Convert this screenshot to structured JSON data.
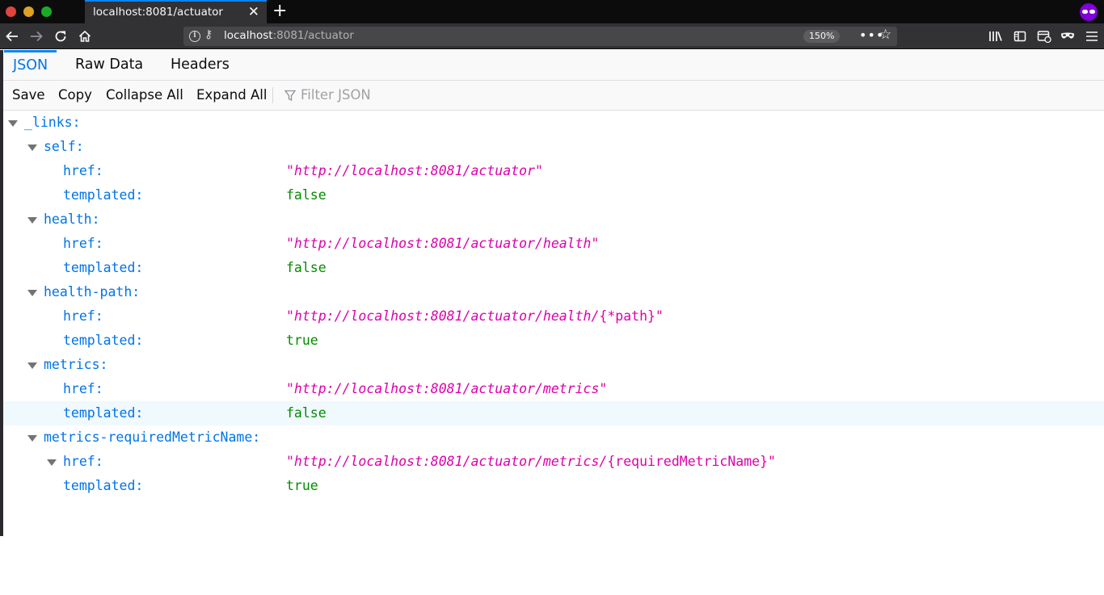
{
  "window": {
    "tab_title": "localhost:8081/actuator",
    "tab_close_glyph": "✕",
    "new_tab_glyph": "+"
  },
  "navbar": {
    "url_host": "localhost",
    "url_rest": ":8081/actuator",
    "zoom": "150%",
    "url_more_glyph": "•••",
    "bookmark_glyph": "☆"
  },
  "json_viewer": {
    "tabs": [
      {
        "label": "JSON",
        "active": true
      },
      {
        "label": "Raw Data",
        "active": false
      },
      {
        "label": "Headers",
        "active": false
      }
    ],
    "toolbar": {
      "save": "Save",
      "copy": "Copy",
      "collapse_all": "Collapse All",
      "expand_all": "Expand All",
      "filter_placeholder": "Filter JSON"
    },
    "tree": {
      "root_key": "_links:",
      "self": {
        "key": "self:",
        "href_key": "href:",
        "href_value": "\"http://localhost:8081/actuator\"",
        "templated_key": "templated:",
        "templated_value": "false"
      },
      "health": {
        "key": "health:",
        "href_key": "href:",
        "href_value": "\"http://localhost:8081/actuator/health\"",
        "templated_key": "templated:",
        "templated_value": "false"
      },
      "health_path": {
        "key": "health-path:",
        "href_key": "href:",
        "href_value_url": "\"http://localhost:8081/actuator/health/",
        "href_value_tail": "{*path}\"",
        "templated_key": "templated:",
        "templated_value": "true"
      },
      "metrics": {
        "key": "metrics:",
        "href_key": "href:",
        "href_value": "\"http://localhost:8081/actuator/metrics\"",
        "templated_key": "templated:",
        "templated_value": "false"
      },
      "metrics_required": {
        "key": "metrics-requiredMetricName:",
        "href_key": "href:",
        "href_value_url": "\"http://localhost:8081/actuator/metrics/",
        "href_value_tail": "{requiredMetricName}\"",
        "templated_key": "templated:",
        "templated_value": "true"
      }
    }
  },
  "colors": {
    "key": "#0074e8",
    "string": "#dd00a9",
    "boolean": "#058b00",
    "active_tab": "#0a84ff",
    "selected_row": "#f0f9fe"
  }
}
